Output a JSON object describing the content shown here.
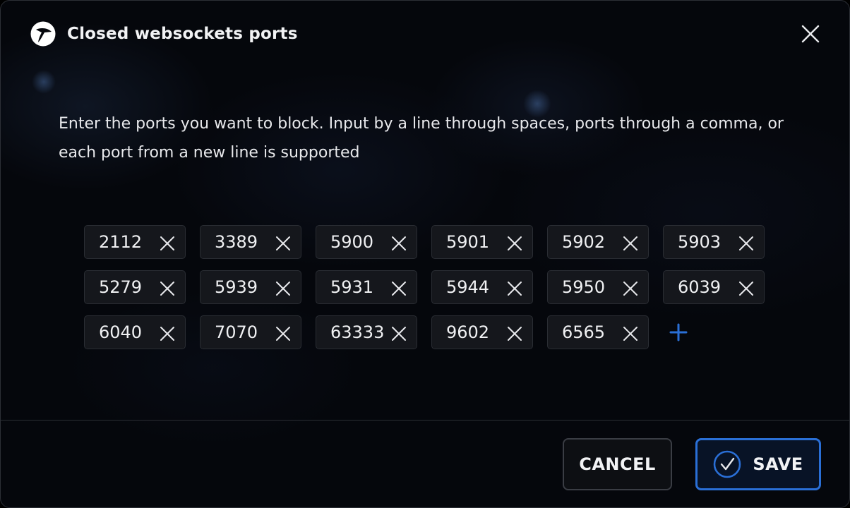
{
  "dialog": {
    "title": "Closed websockets ports",
    "description": "Enter the ports you want to block. Input by a line through spaces, ports through a comma, or each port from a new line is supported"
  },
  "ports": [
    "2112",
    "3389",
    "5900",
    "5901",
    "5902",
    "5903",
    "5279",
    "5939",
    "5931",
    "5944",
    "5950",
    "6039",
    "6040",
    "7070",
    "63333",
    "9602",
    "6565"
  ],
  "buttons": {
    "cancel_label": "CANCEL",
    "save_label": "SAVE"
  },
  "colors": {
    "accent": "#2a6fd6",
    "background": "#05070c",
    "chip_bg": "#15171c"
  },
  "icons": {
    "app": "app-logo-icon",
    "close": "close-icon",
    "remove": "remove-port-icon",
    "add": "plus-icon",
    "save": "check-circle-icon"
  }
}
